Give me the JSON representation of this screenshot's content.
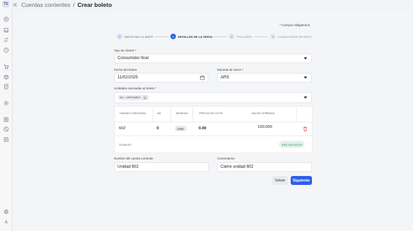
{
  "user": {
    "initials": "TS"
  },
  "rail_icons": [
    "plus-circle-icon",
    "inbox-icon",
    "transfer-icon",
    "clock-icon",
    "cart-icon",
    "box-icon",
    "receipt-icon",
    "settings-icon",
    "grid-icon",
    "block-icon",
    "doc-icon",
    "gear-icon",
    "font-icon"
  ],
  "breadcrumb": {
    "parent": "Cuentas corrientes",
    "separator": "/",
    "current": "Crear boleto"
  },
  "form": {
    "required_note": "* Campos obligatorios",
    "steps": [
      {
        "number": "✓",
        "label": "DATOS DEL CLIENTE",
        "state": "done"
      },
      {
        "number": "2",
        "label": "DETALLES DE LA VENTA",
        "state": "active"
      },
      {
        "number": "3",
        "label": "TITULARES",
        "state": "todo"
      },
      {
        "number": "4",
        "label": "CONDICIONES DE PAGO",
        "state": "todo"
      }
    ],
    "client_type": {
      "label": "Tipo de cliente *",
      "value": "Consumidor final"
    },
    "date": {
      "label": "Fecha del boleto",
      "value": "11/02/2025"
    },
    "currency": {
      "label": "Moneda de cierre *",
      "value": "ARS"
    },
    "units": {
      "label": "Unidades asociadas al boleto *",
      "chip": "602 - DISPONIBLE"
    },
    "table": {
      "headers": [
        "UNIDAD FUNCIONAL",
        "M2",
        "MONEDA",
        "PRECIO DE LISTA",
        "VALOR CERRADO"
      ],
      "rows": [
        {
          "unit": "602",
          "m2": "0",
          "currency": "USD",
          "list_price": "0.00",
          "closed_value": "100.000"
        }
      ],
      "totals_label": "TOTALES",
      "total_value": "ARS 100.000,00"
    },
    "account_name": {
      "label": "Nombre del cuenta corriente",
      "value": "Unidad 602"
    },
    "comments": {
      "label": "Comentarios",
      "value": "Cierre unidad 602"
    },
    "buttons": {
      "back": "Volver",
      "next": "Siguiente"
    }
  },
  "colors": {
    "primary": "#2f5fe8",
    "success_bg": "#dff3e6",
    "success_text": "#2e8a52",
    "danger": "#e5484d"
  }
}
